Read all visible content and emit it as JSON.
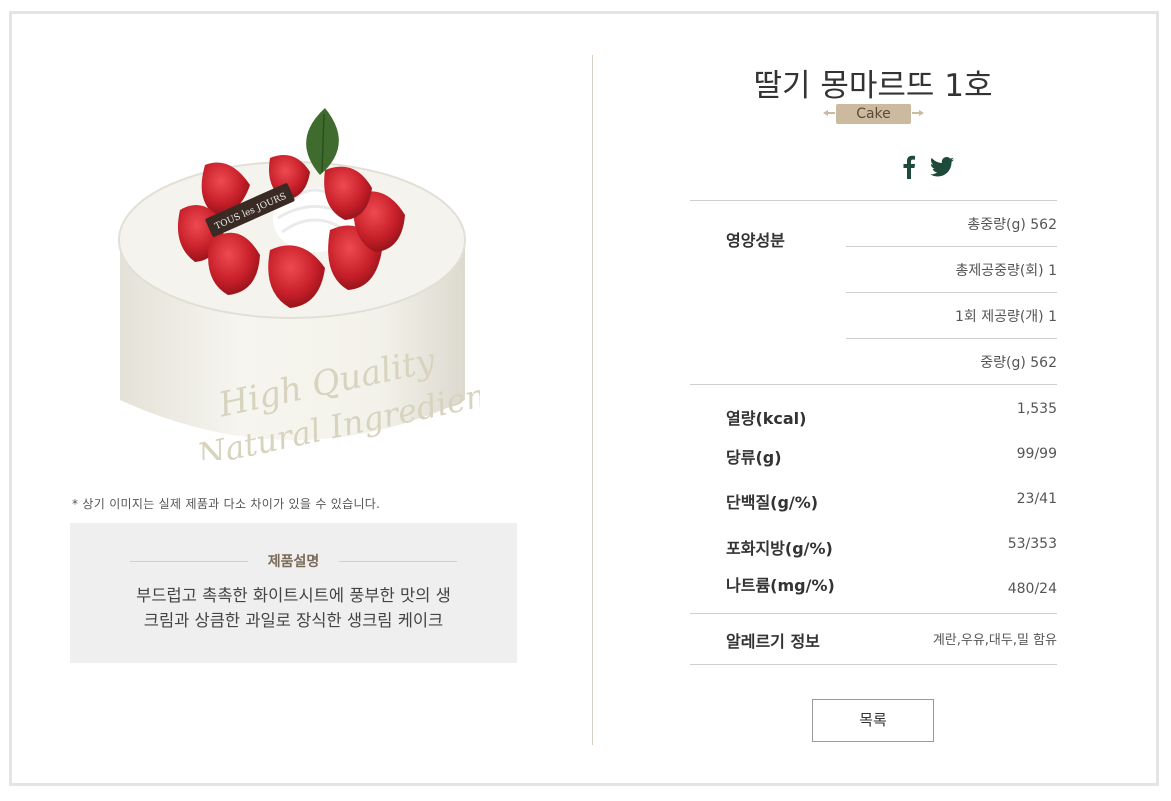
{
  "product": {
    "title": "딸기 몽마르뜨 1호",
    "category": "Cake",
    "image_logo_text": "TOUS les JOURS",
    "image_text_line1": "High Quality",
    "image_text_line2": "Natural Ingredients"
  },
  "disclaimer": "* 상기 이미지는 실제 제품과 다소 차이가 있을 수 있습니다.",
  "description": {
    "title": "제품설명",
    "line1": "부드럽고 촉촉한 화이트시트에 풍부한 맛의 생",
    "line2": "크림과 상큼한 과일로 장식한 생크림 케이크"
  },
  "social": {
    "facebook": "facebook-icon",
    "twitter": "twitter-icon"
  },
  "nutrition": {
    "section_label": "영양성분",
    "weights": [
      {
        "text": "총중량(g) 562"
      },
      {
        "text": "총제공중량(회) 1"
      },
      {
        "text": "1회 제공량(개) 1"
      },
      {
        "text": "중량(g) 562"
      }
    ],
    "rows": [
      {
        "label": "열량(kcal)",
        "value": "1,535"
      },
      {
        "label": "당류(g)",
        "value": "99/99"
      },
      {
        "label": "단백질(g/%)",
        "value": "23/41"
      },
      {
        "label": "포화지방(g/%)",
        "value": "53/353"
      },
      {
        "label": "나트륨(mg/%)",
        "value": "480/24"
      }
    ],
    "allergy_label": "알레르기 정보",
    "allergy_value": "계란,우유,대두,밀 함유"
  },
  "buttons": {
    "list_label": "목록"
  },
  "colors": {
    "accent": "#cbb9a0",
    "icon": "#1e4a3a",
    "strawberry": "#c8202a"
  }
}
